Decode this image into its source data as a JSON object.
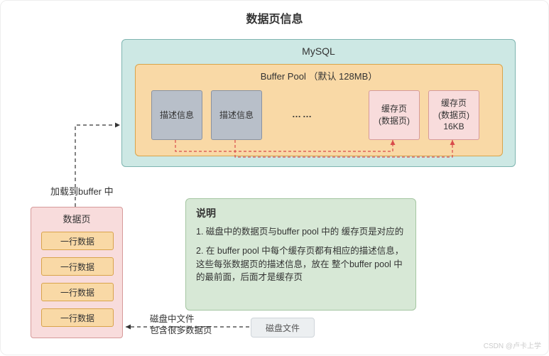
{
  "title": "数据页信息",
  "mysql": {
    "label": "MySQL"
  },
  "bufferPool": {
    "label": "Buffer Pool  （默认 128MB）",
    "descItems": [
      "描述信息",
      "描述信息"
    ],
    "dots": "……",
    "cacheItems": [
      "缓存页\n(数据页)",
      "缓存页\n(数据页)\n16KB"
    ]
  },
  "loadLabel": "加载到buffer 中",
  "dataPage": {
    "title": "数据页",
    "rows": [
      "一行数据",
      "一行数据",
      "一行数据",
      "一行数据"
    ]
  },
  "explain": {
    "title": "说明",
    "p1": "1. 磁盘中的数据页与buffer pool 中的 缓存页是对应的",
    "p2": "2. 在 buffer pool 中每个缓存页都有相应的描述信息，这些每张数据页的描述信息，放在 整个buffer pool 中的最前面，后面才是缓存页"
  },
  "diskLabel": "磁盘中文件\n包含很多数据页",
  "diskFile": "磁盘文件",
  "watermark": "CSDN @卢卡上学"
}
